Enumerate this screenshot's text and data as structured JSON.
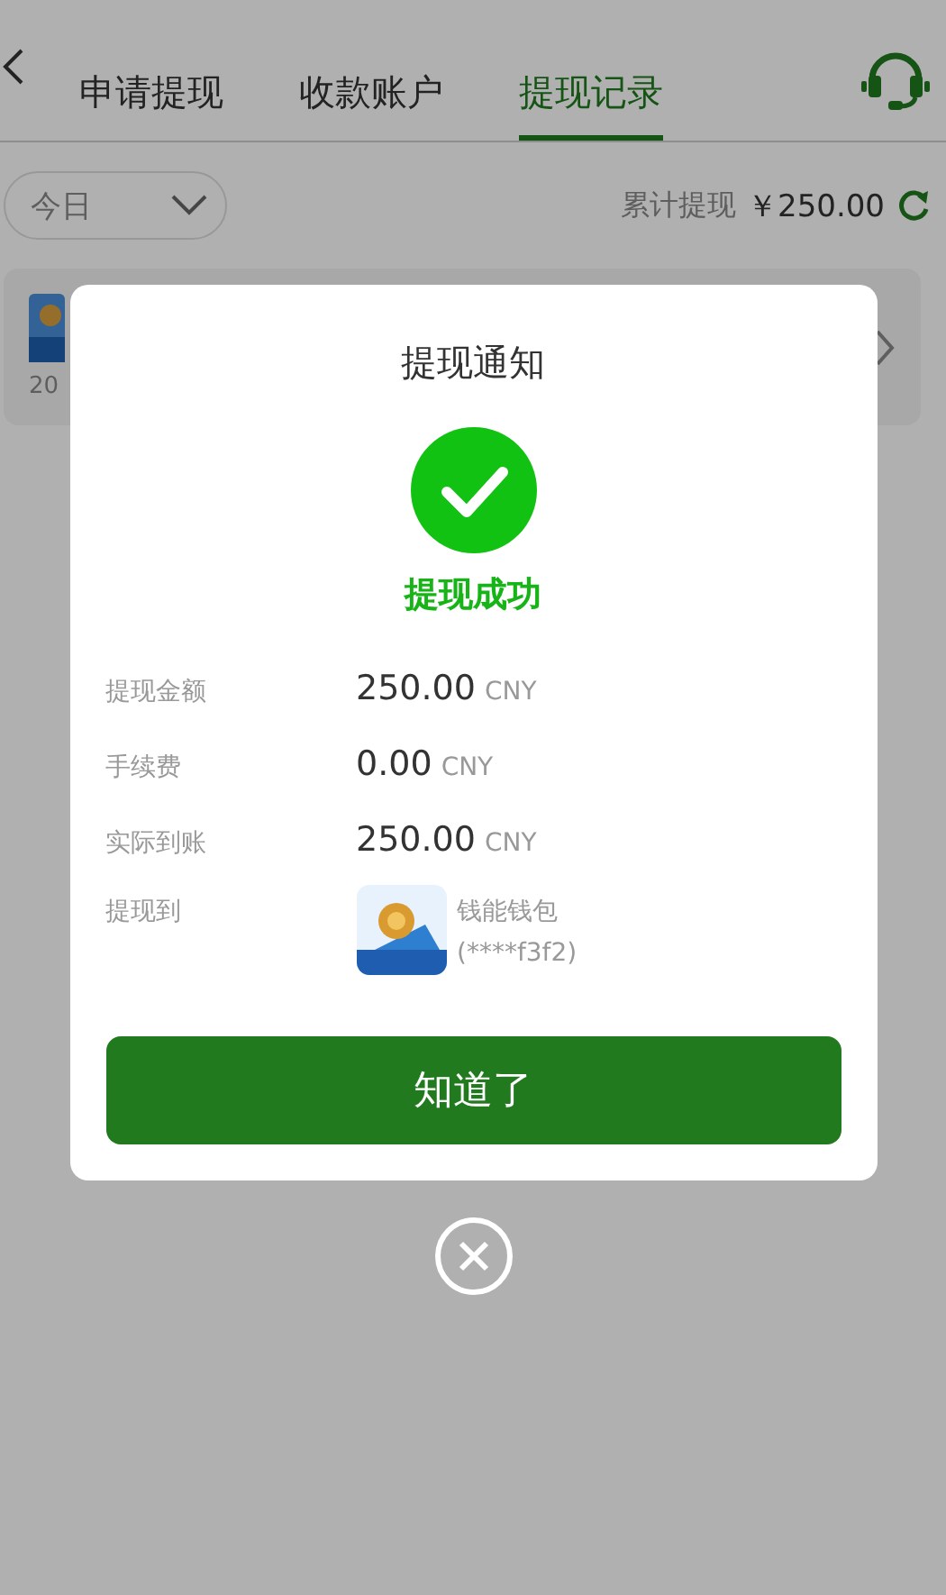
{
  "tabs": [
    {
      "label": "申请提现",
      "selected": false
    },
    {
      "label": "收款账户",
      "selected": false
    },
    {
      "label": "提现记录",
      "selected": true
    }
  ],
  "filter": {
    "value": "今日"
  },
  "total": {
    "label": "累计提现",
    "amount": "￥250.00"
  },
  "record_card": {
    "date_fragment": "20"
  },
  "dialog": {
    "title": "提现通知",
    "status": "提现成功",
    "rows": [
      {
        "kind": "amount",
        "label": "提现金额",
        "value": "250.00",
        "unit": "CNY"
      },
      {
        "kind": "amount",
        "label": "手续费",
        "value": "0.00",
        "unit": "CNY"
      },
      {
        "kind": "amount",
        "label": "实际到账",
        "value": "250.00",
        "unit": "CNY"
      },
      {
        "kind": "account",
        "label": "提现到",
        "name": "钱能钱包",
        "account": "(****f3f2)"
      }
    ],
    "button": "知道了"
  }
}
